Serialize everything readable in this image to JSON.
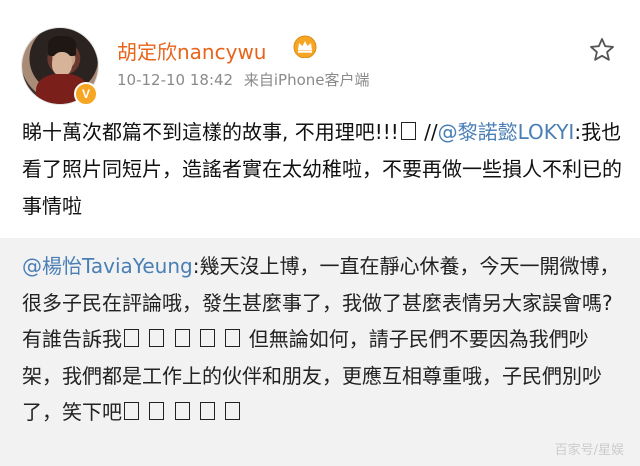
{
  "header": {
    "username": "胡定欣nancywu",
    "timestamp": "10-12-10 18:42",
    "source": "来自iPhone客户端",
    "icons": {
      "vip": "vip-crown-icon",
      "verified": "verified-badge-icon",
      "favorite": "star-icon"
    }
  },
  "post": {
    "line1": "睇十萬次都篇不到這樣的故事, 不用理吧!!!",
    "repost_marker": "//",
    "mention": "@黎諾懿LOKYI",
    "quoted": ":我也看了照片同短片，造謠者實在太幼稚啦，不要再做一些損人不利已的事情啦"
  },
  "repost": {
    "mention": "@楊怡TaviaYeung",
    "text_a": ":幾天沒上博，一直在靜心休養，今天一開微博，很多子民在評論哦，發生甚麼事了，我做了甚麼表情另大家誤會嗎? 有誰告訴我",
    "text_b": "但無論如何，請子民們不要因為我們吵架，我們都是工作上的伙伴和朋友，更應互相尊重哦，子民們別吵了，笑下吧"
  },
  "watermark": "百家号/星娱"
}
